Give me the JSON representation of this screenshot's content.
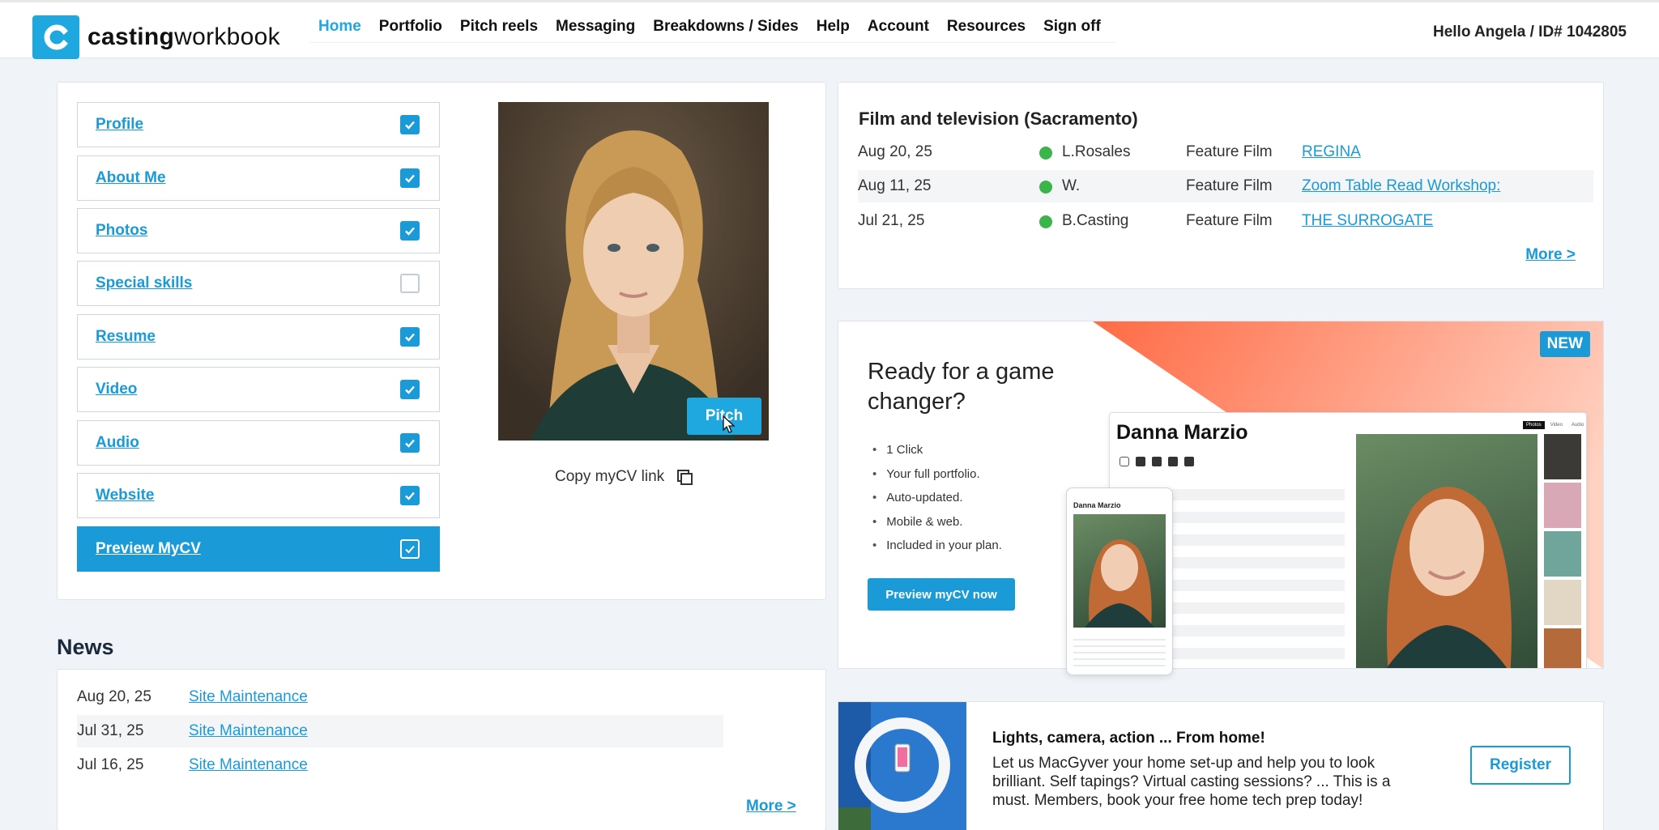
{
  "header": {
    "logo_bold": "casting",
    "logo_light": "workbook",
    "nav": [
      "Home",
      "Portfolio",
      "Pitch reels",
      "Messaging",
      "Breakdowns / Sides",
      "Help",
      "Account",
      "Resources",
      "Sign off"
    ],
    "active_nav": "Home",
    "greeting": "Hello Angela / ID# 1042805"
  },
  "checklist": {
    "items": [
      {
        "label": "Profile",
        "checked": true
      },
      {
        "label": "About Me",
        "checked": true
      },
      {
        "label": "Photos",
        "checked": true
      },
      {
        "label": "Special skills",
        "checked": false
      },
      {
        "label": "Resume",
        "checked": true
      },
      {
        "label": "Video",
        "checked": true
      },
      {
        "label": "Audio",
        "checked": true
      },
      {
        "label": "Website",
        "checked": true
      }
    ],
    "preview_label": "Preview MyCV"
  },
  "photo": {
    "pitch_label": "Pitch",
    "copy_link_label": "Copy myCV link"
  },
  "film": {
    "heading": "Film and television (Sacramento)",
    "rows": [
      {
        "date": "Aug 20, 25",
        "who": "L.Rosales",
        "type": "Feature Film",
        "title": "REGINA"
      },
      {
        "date": "Aug 11, 25",
        "who": "W.",
        "type": "Feature Film",
        "title": "Zoom Table Read Workshop:"
      },
      {
        "date": "Jul 21, 25",
        "who": "B.Casting",
        "type": "Feature Film",
        "title": "THE SURROGATE"
      }
    ],
    "more_label": "More >"
  },
  "promo": {
    "badge": "NEW",
    "title": "Ready for a game changer?",
    "bullets": [
      "1 Click",
      "Your full portfolio.",
      "Auto-updated.",
      "Mobile & web.",
      "Included in your plan."
    ],
    "button_label": "Preview myCV now",
    "mock_name": "Danna Marzio",
    "mock_tabs": [
      "Photos",
      "Video",
      "Audio"
    ]
  },
  "news": {
    "heading": "News",
    "rows": [
      {
        "date": "Aug 20, 25",
        "title": "Site Maintenance"
      },
      {
        "date": "Jul 31, 25",
        "title": "Site Maintenance"
      },
      {
        "date": "Jul 16, 25",
        "title": "Site Maintenance"
      }
    ],
    "more_label": "More >"
  },
  "lights": {
    "title": "Lights, camera, action ... From home!",
    "body": "Let us MacGyver your home set-up and help you to look brilliant. Self tapings? Virtual casting sessions? ... This is a must. Members, book your free home tech prep today!",
    "register_label": "Register"
  },
  "colors": {
    "accent": "#1a9ad6",
    "logo": "#1fa7e0",
    "status_green": "#3ab549",
    "promo_gradient": "#ff7a52"
  }
}
